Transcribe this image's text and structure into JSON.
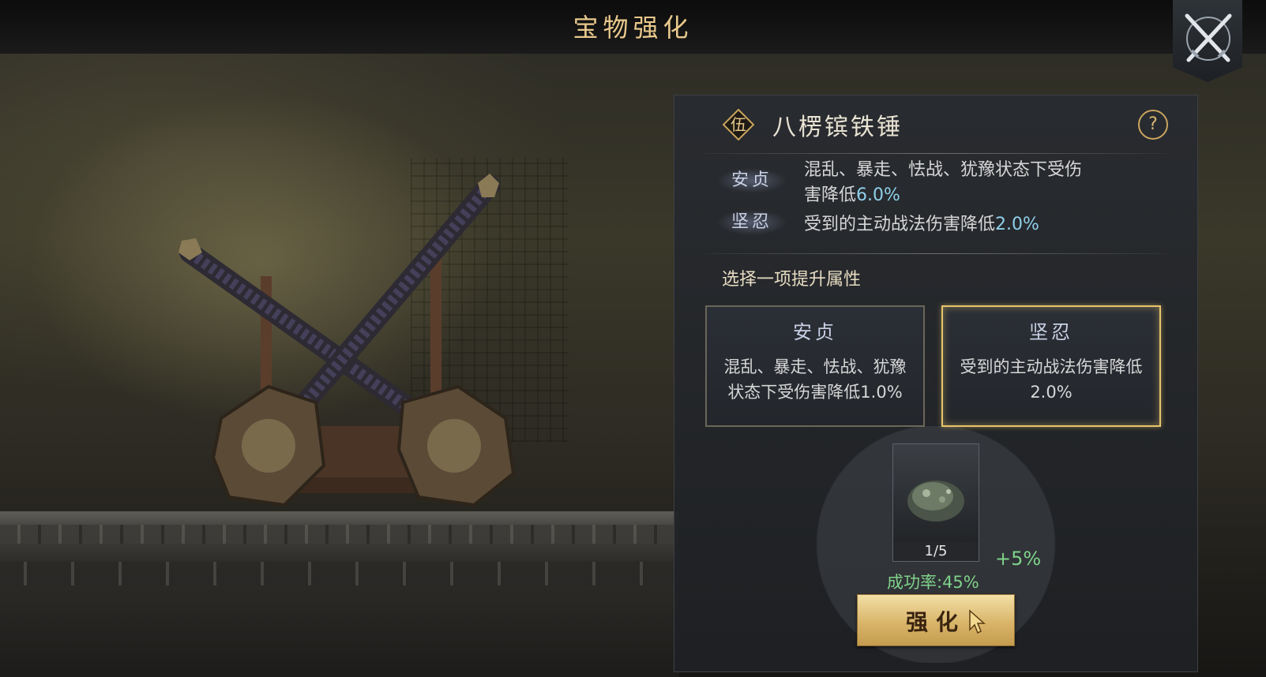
{
  "header": {
    "title": "宝物强化"
  },
  "treasure": {
    "grade": "伍",
    "name": "八楞镔铁锤"
  },
  "current_attributes": [
    {
      "name": "安贞",
      "desc_prefix": "混乱、暴走、怯战、犹豫状态下受伤",
      "desc_line2": "害降低",
      "value": "6.0%"
    },
    {
      "name": "坚忍",
      "desc_prefix": "受到的主动战法伤害降低",
      "value": "2.0%"
    }
  ],
  "upgrade": {
    "prompt": "选择一项提升属性",
    "options": [
      {
        "name": "安贞",
        "line1": "混乱、暴走、怯战、犹豫",
        "line2": "状态下受伤害降低1.0%",
        "selected": false
      },
      {
        "name": "坚忍",
        "line1": "受到的主动战法伤害降低",
        "line2": "2.0%",
        "selected": true
      }
    ]
  },
  "material": {
    "count": "1/5",
    "bonus": "+5%",
    "icon": "ore-stone-icon"
  },
  "success_rate": "成功率:45%",
  "actions": {
    "enhance_label": "强化"
  },
  "colors": {
    "title_gold": "#e9c98c",
    "highlight_blue": "#8fd0ea",
    "success_green": "#7fd28a",
    "selected_border": "#e5c46b",
    "button_gold": "#d9b56a"
  }
}
